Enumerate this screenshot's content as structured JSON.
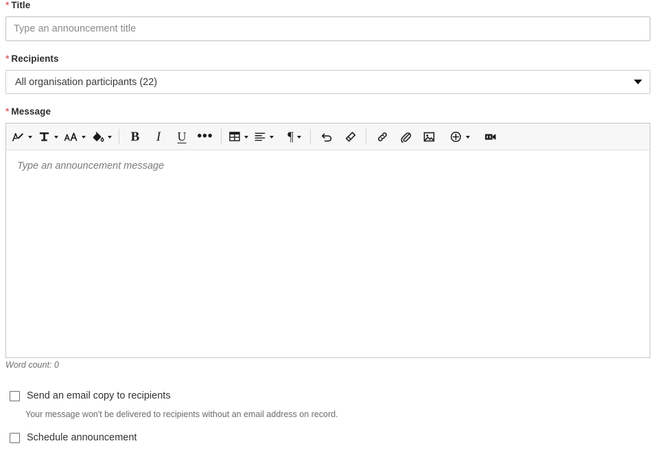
{
  "form": {
    "title_field": {
      "label": "Title",
      "required_marker": "*",
      "placeholder": "Type an announcement title",
      "value": ""
    },
    "recipients_field": {
      "label": "Recipients",
      "required_marker": "*",
      "selected": "All organisation participants (22)"
    },
    "message_field": {
      "label": "Message",
      "required_marker": "*",
      "placeholder": "Type an announcement message",
      "value": "",
      "word_count": "Word count: 0"
    }
  },
  "toolbar": {
    "items": [
      {
        "name": "styles-icon",
        "title": "Styles",
        "has_caret": true
      },
      {
        "name": "text-color-icon",
        "title": "Text colour",
        "has_caret": true
      },
      {
        "name": "font-size-icon",
        "title": "Font size",
        "has_caret": true
      },
      {
        "name": "background-color-icon",
        "title": "Background colour",
        "has_caret": true
      },
      {
        "name": "bold-icon",
        "title": "Bold",
        "glyph": "B",
        "has_caret": false
      },
      {
        "name": "italic-icon",
        "title": "Italic",
        "glyph": "I",
        "has_caret": false
      },
      {
        "name": "underline-icon",
        "title": "Underline",
        "glyph": "U",
        "has_caret": false
      },
      {
        "name": "more-formatting-icon",
        "title": "More",
        "glyph": "•••",
        "has_caret": false
      },
      {
        "name": "table-icon",
        "title": "Table",
        "has_caret": true
      },
      {
        "name": "align-icon",
        "title": "Alignment",
        "has_caret": true
      },
      {
        "name": "paragraph-icon",
        "title": "Paragraph",
        "glyph": "¶",
        "has_caret": true
      },
      {
        "name": "undo-icon",
        "title": "Undo",
        "has_caret": false
      },
      {
        "name": "clear-formatting-icon",
        "title": "Clear formatting",
        "has_caret": false
      },
      {
        "name": "link-icon",
        "title": "Insert link",
        "has_caret": false
      },
      {
        "name": "attachment-icon",
        "title": "Attach file",
        "has_caret": false
      },
      {
        "name": "image-icon",
        "title": "Insert image",
        "has_caret": false
      },
      {
        "name": "insert-more-icon",
        "title": "Insert",
        "has_caret": true
      },
      {
        "name": "video-icon",
        "title": "Insert video",
        "has_caret": false
      }
    ]
  },
  "options": {
    "email_copy": {
      "label": "Send an email copy to recipients",
      "checked": false,
      "helper": "Your message won't be delivered to recipients without an email address on record."
    },
    "schedule": {
      "label": "Schedule announcement",
      "checked": false
    }
  },
  "colors": {
    "required_star": "#e06666",
    "border": "#c6c6c6",
    "toolbar_bg": "#f7f7f7",
    "text": "#333333",
    "placeholder": "#8b8b8b"
  }
}
